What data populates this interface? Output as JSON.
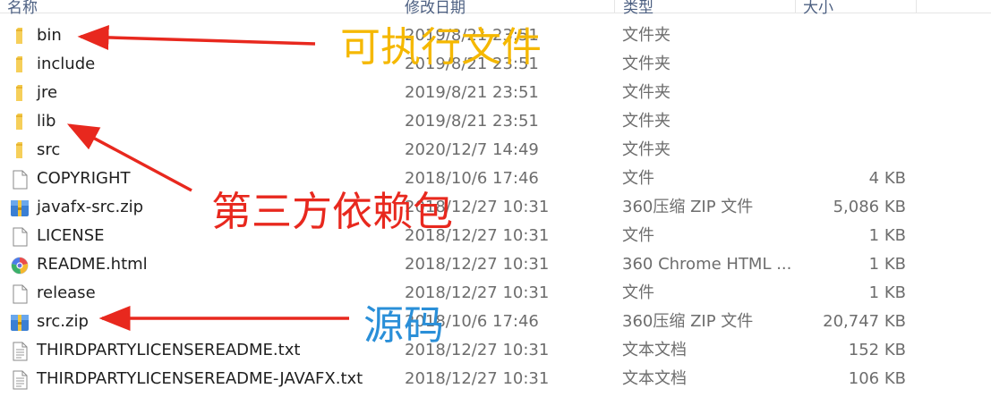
{
  "header": {
    "columns": [
      {
        "label": "名称"
      },
      {
        "label": "修改日期"
      },
      {
        "label": "类型"
      },
      {
        "label": "大小"
      }
    ]
  },
  "files": [
    {
      "name": "bin",
      "date": "2019/8/21 23:51",
      "type": "文件夹",
      "size": "",
      "icon": "folder-icon"
    },
    {
      "name": "include",
      "date": "2019/8/21 23:51",
      "type": "文件夹",
      "size": "",
      "icon": "folder-icon"
    },
    {
      "name": "jre",
      "date": "2019/8/21 23:51",
      "type": "文件夹",
      "size": "",
      "icon": "folder-icon"
    },
    {
      "name": "lib",
      "date": "2019/8/21 23:51",
      "type": "文件夹",
      "size": "",
      "icon": "folder-icon"
    },
    {
      "name": "src",
      "date": "2020/12/7 14:49",
      "type": "文件夹",
      "size": "",
      "icon": "folder-icon"
    },
    {
      "name": "COPYRIGHT",
      "date": "2018/10/6 17:46",
      "type": "文件",
      "size": "4 KB",
      "icon": "file-icon"
    },
    {
      "name": "javafx-src.zip",
      "date": "2018/12/27 10:31",
      "type": "360压缩 ZIP 文件",
      "size": "5,086 KB",
      "icon": "zip-icon"
    },
    {
      "name": "LICENSE",
      "date": "2018/12/27 10:31",
      "type": "文件",
      "size": "1 KB",
      "icon": "file-icon"
    },
    {
      "name": "README.html",
      "date": "2018/12/27 10:31",
      "type": "360 Chrome HTML ...",
      "size": "1 KB",
      "icon": "html-icon"
    },
    {
      "name": "release",
      "date": "2018/12/27 10:31",
      "type": "文件",
      "size": "1 KB",
      "icon": "file-icon"
    },
    {
      "name": "src.zip",
      "date": "2018/10/6 17:46",
      "type": "360压缩 ZIP 文件",
      "size": "20,747 KB",
      "icon": "zip-icon"
    },
    {
      "name": "THIRDPARTYLICENSEREADME.txt",
      "date": "2018/12/27 10:31",
      "type": "文本文档",
      "size": "152 KB",
      "icon": "text-file-icon"
    },
    {
      "name": "THIRDPARTYLICENSEREADME-JAVAFX.txt",
      "date": "2018/12/27 10:31",
      "type": "文本文档",
      "size": "106 KB",
      "icon": "text-file-icon"
    }
  ],
  "annotations": [
    {
      "text": "可执行文件",
      "color": "#f5b800"
    },
    {
      "text": "第三方依赖包",
      "color": "#e8281e"
    },
    {
      "text": "源码",
      "color": "#2a8fd8"
    }
  ]
}
